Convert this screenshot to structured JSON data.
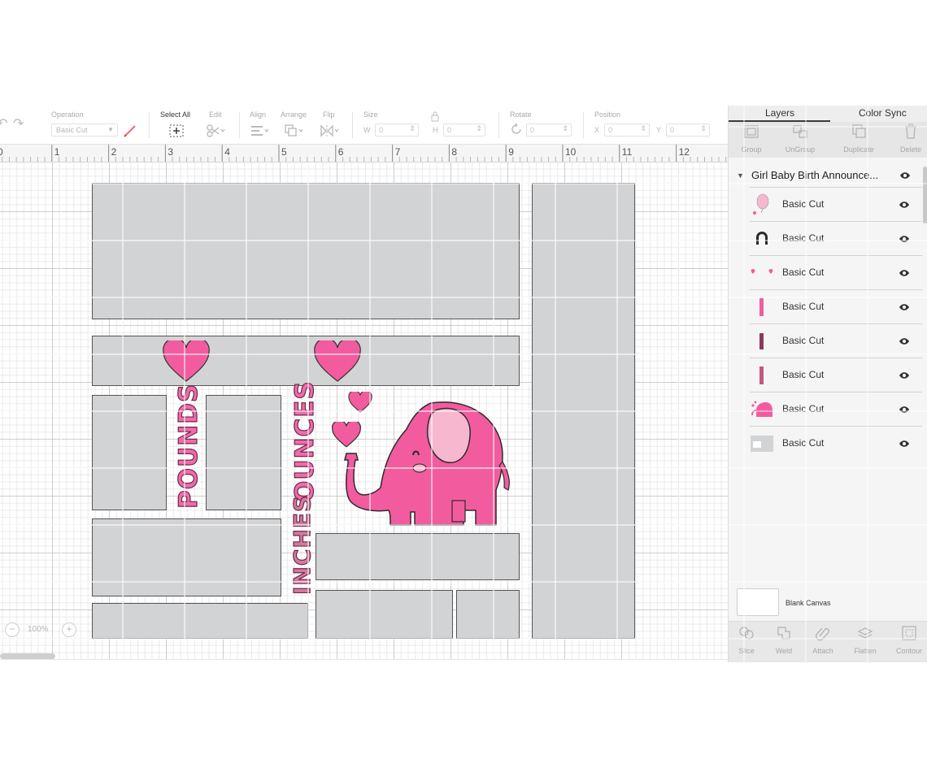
{
  "toolbar": {
    "operation_label": "Operation",
    "operation_value": "Basic Cut",
    "select_all_label": "Select All",
    "edit_label": "Edit",
    "align_label": "Align",
    "arrange_label": "Arrange",
    "flip_label": "Flip",
    "size_label": "Size",
    "width_letter": "W",
    "width_value": "0",
    "height_letter": "H",
    "height_value": "0",
    "rotate_label": "Rotate",
    "rotate_value": "0",
    "position_label": "Position",
    "x_letter": "X",
    "x_value": "0",
    "y_letter": "Y",
    "y_value": "0"
  },
  "ruler": {
    "numbers": [
      "0",
      "1",
      "2",
      "3",
      "4",
      "5",
      "6",
      "7",
      "8",
      "9",
      "10",
      "11",
      "12"
    ]
  },
  "canvas": {
    "text_pounds": "POUNDS",
    "text_ounces": "OUNCES",
    "text_inches": "INCHES",
    "zoom_value": "100%",
    "zoom_minus": "−",
    "zoom_plus": "+"
  },
  "layers_panel": {
    "tabs": {
      "layers": "Layers",
      "color_sync": "Color Sync"
    },
    "actions": [
      "Group",
      "UnGroup",
      "Duplicate",
      "Delete"
    ],
    "group_title": "Girl Baby Birth Announce...",
    "layers": [
      {
        "name": "Basic Cut",
        "thumb": "balloon-thumb-icon"
      },
      {
        "name": "Basic Cut",
        "thumb": "arch-thumb-icon"
      },
      {
        "name": "Basic Cut",
        "thumb": "hearts-thumb-icon"
      },
      {
        "name": "Basic Cut",
        "thumb": "pounds-text-thumb-icon"
      },
      {
        "name": "Basic Cut",
        "thumb": "inches-text-thumb-icon"
      },
      {
        "name": "Basic Cut",
        "thumb": "ounces-text-thumb-icon"
      },
      {
        "name": "Basic Cut",
        "thumb": "elephant-thumb-icon"
      },
      {
        "name": "Basic Cut",
        "thumb": "panels-thumb-icon"
      }
    ],
    "blank_canvas_label": "Blank Canvas",
    "bottom_actions": [
      "Slice",
      "Weld",
      "Attach",
      "Flatten",
      "Contour"
    ]
  },
  "colors": {
    "pink": "#f25c9e",
    "light_pink": "#f7b8cf",
    "panel_gray": "#d2d3d5",
    "outline": "#2b2b2b"
  }
}
